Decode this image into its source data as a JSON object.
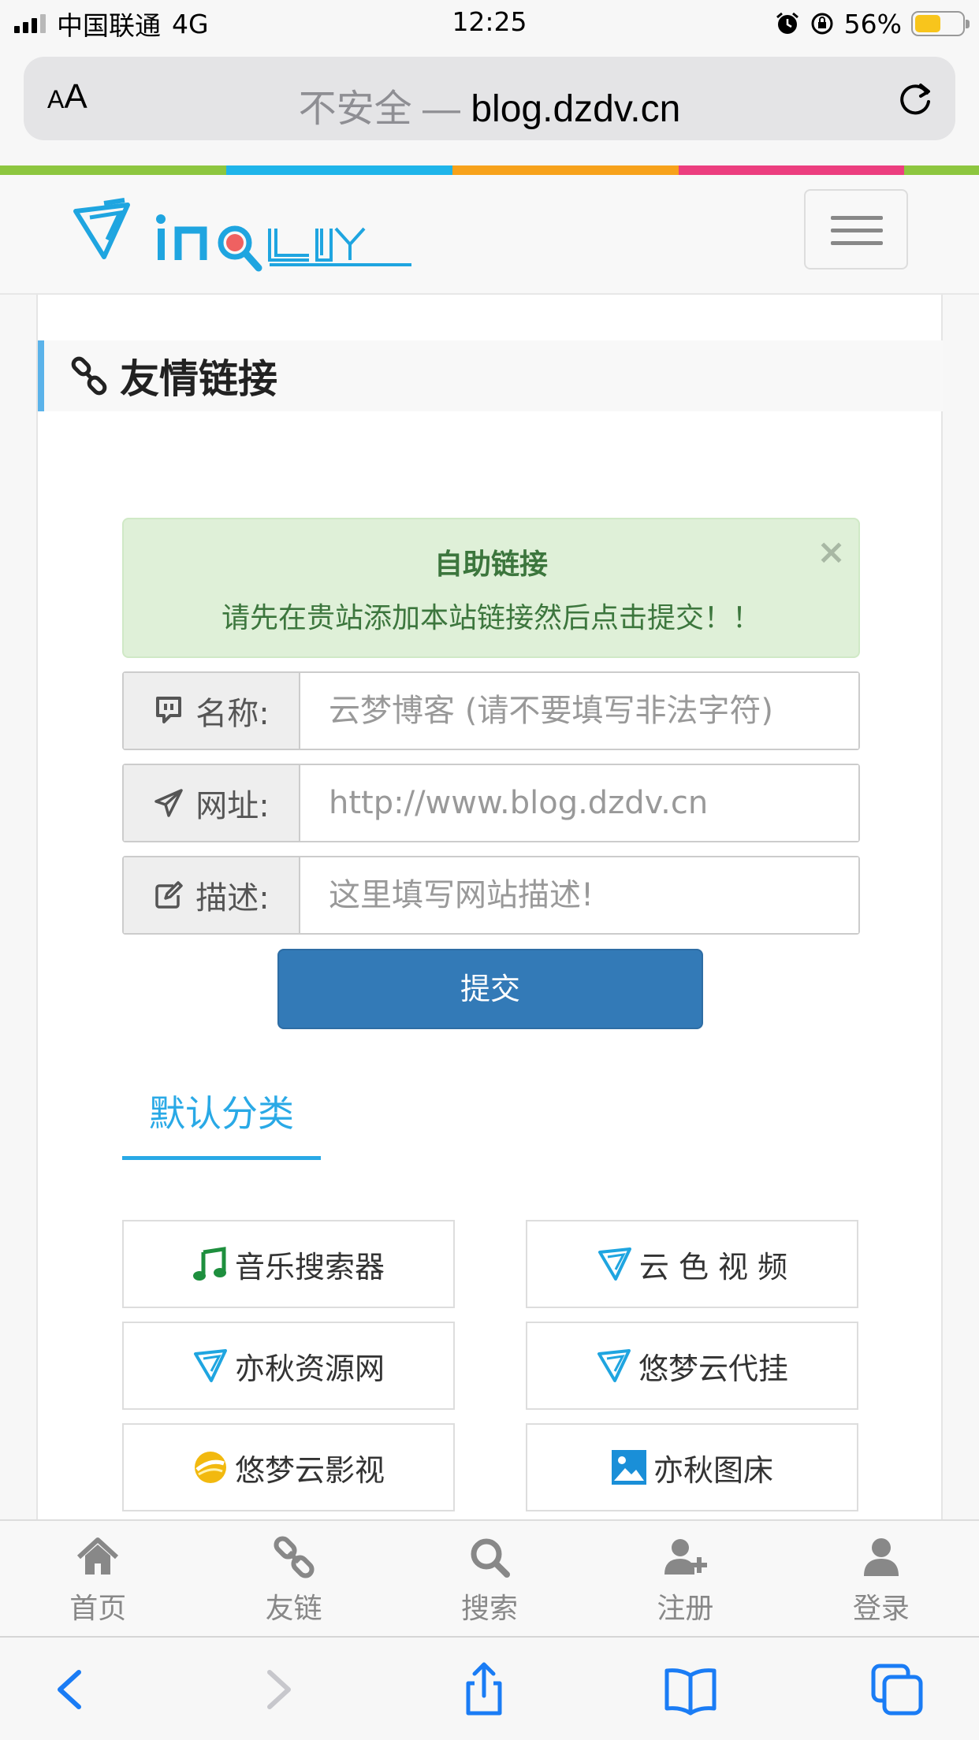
{
  "status_bar": {
    "carrier": "中国联通",
    "network": "4G",
    "time": "12:25",
    "battery": "56%",
    "battery_level": 0.56
  },
  "browser": {
    "aa_small": "A",
    "aa_large": "A",
    "insecure_label": "不安全 — ",
    "domain": "blog.dzdv.cn"
  },
  "color_strip": [
    "#8dc63f",
    "#1fb5ea",
    "#f7a21b",
    "#ec3e7f",
    "#8dc63f"
  ],
  "page": {
    "section_title": "友情链接",
    "alert": {
      "title": "自助链接",
      "text": "请先在贵站添加本站链接然后点击提交！！",
      "close": "×"
    },
    "form": {
      "name_label": "名称:",
      "name_placeholder": "云梦博客 (请不要填写非法字符)",
      "url_label": "网址:",
      "url_placeholder": "http://www.blog.dzdv.cn",
      "desc_label": "描述:",
      "desc_placeholder": "这里填写网站描述!",
      "submit": "提交"
    },
    "category_tab": "默认分类",
    "links": [
      {
        "label": "音乐搜索器",
        "icon": "music-note-icon"
      },
      {
        "label": "云 色 视 频",
        "icon": "site-logo-icon"
      },
      {
        "label": "亦秋资源网",
        "icon": "site-logo-icon"
      },
      {
        "label": "悠梦云代挂",
        "icon": "site-logo-icon"
      },
      {
        "label": "悠梦云影视",
        "icon": "yellow-ball-icon"
      },
      {
        "label": "亦秋图床",
        "icon": "image-icon"
      }
    ]
  },
  "site_nav": [
    {
      "label": "首页",
      "icon": "home-icon"
    },
    {
      "label": "友链",
      "icon": "chain-link-icon"
    },
    {
      "label": "搜索",
      "icon": "search-icon"
    },
    {
      "label": "注册",
      "icon": "user-plus-icon"
    },
    {
      "label": "登录",
      "icon": "user-icon"
    }
  ],
  "accent_colors": {
    "primary_button": "#337ab7",
    "tab_accent": "#29a9e6",
    "alert_bg": "#dff0d8",
    "alert_text": "#3c763d"
  }
}
